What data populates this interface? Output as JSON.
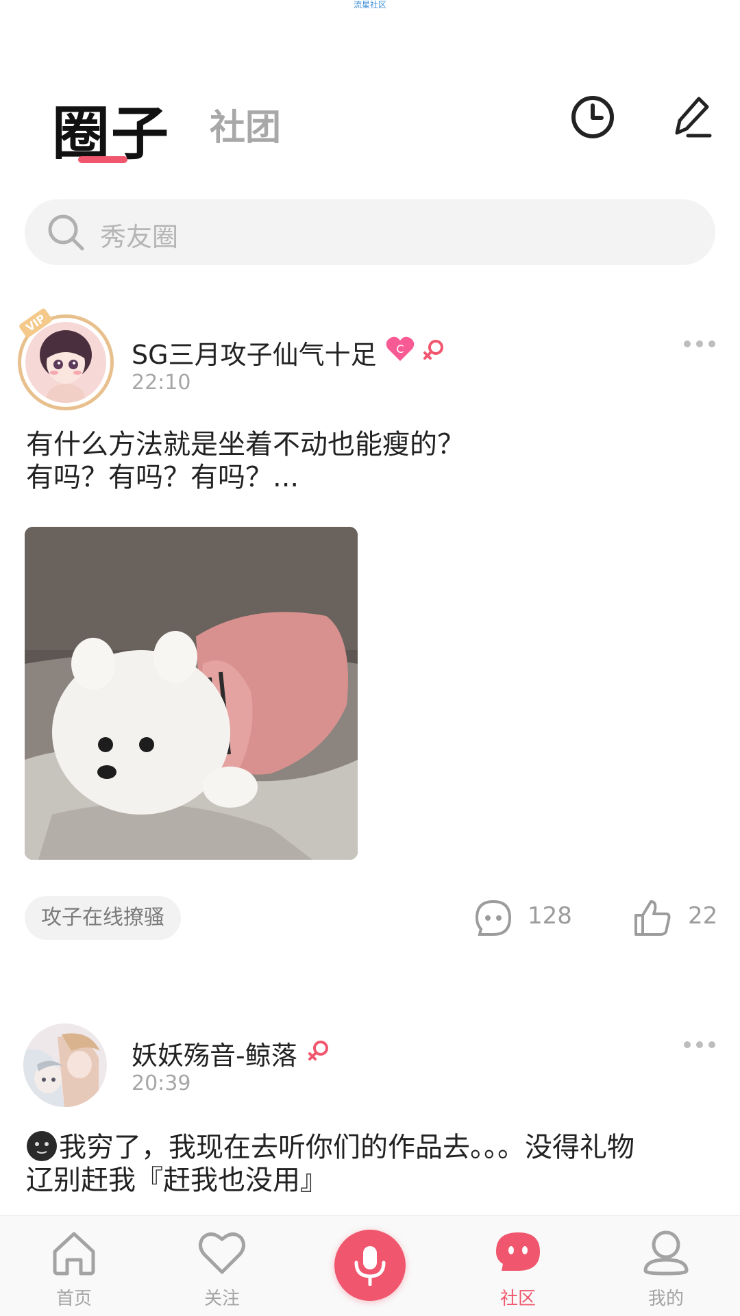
{
  "watermark": "流星社区",
  "tabs": {
    "active": "圈子",
    "inactive": "社团"
  },
  "header_icons": [
    "clock-icon",
    "pen-icon"
  ],
  "search": {
    "placeholder": "秀友圈"
  },
  "posts": [
    {
      "username": "SG三月攻子仙气十足",
      "time": "22:10",
      "vip": "VIP",
      "level_badge": "C",
      "text_line1": "有什么方法就是坐着不动也能瘦的？",
      "text_line2": "有吗？有吗？有吗？...",
      "tag": "攻子在线撩骚",
      "comments": "128",
      "likes": "22"
    },
    {
      "username": "妖妖殇音-鲸落",
      "time": "20:39",
      "text_line1": "我穷了，我现在去听你们的作品去。。。没得礼物",
      "text_line2": "辽别赶我『赶我也没用』"
    }
  ],
  "tabbar": [
    {
      "label": "首页",
      "icon": "home-icon"
    },
    {
      "label": "关注",
      "icon": "heart-icon"
    },
    {
      "label": "",
      "icon": "mic-icon"
    },
    {
      "label": "社区",
      "icon": "chat-bubble-icon",
      "active": true
    },
    {
      "label": "我的",
      "icon": "profile-icon"
    }
  ],
  "colors": {
    "accent": "#f0566d",
    "vip_gold": "#e8c08d"
  }
}
